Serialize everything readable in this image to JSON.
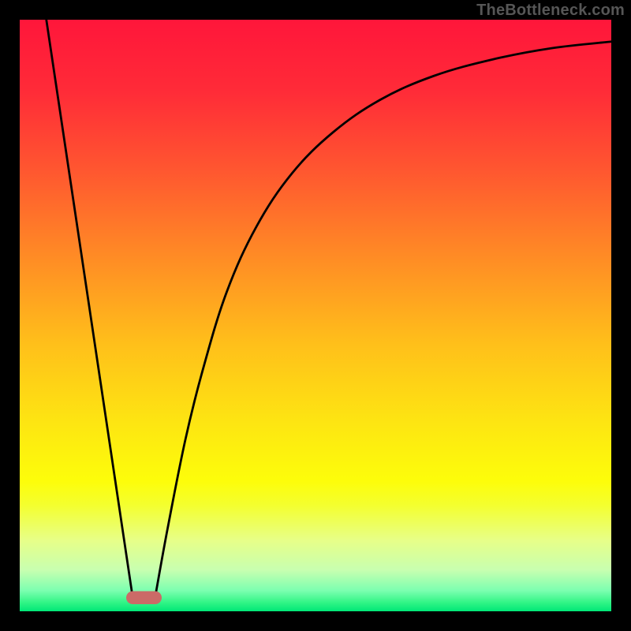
{
  "watermark": "TheBottleneck.com",
  "chart_data": {
    "type": "line",
    "title": "",
    "xlabel": "",
    "ylabel": "",
    "xlim": [
      0,
      100
    ],
    "ylim": [
      0,
      100
    ],
    "gradient_stops": [
      {
        "offset": 0.0,
        "color": "#ff163a"
      },
      {
        "offset": 0.12,
        "color": "#ff2b38"
      },
      {
        "offset": 0.25,
        "color": "#ff5530"
      },
      {
        "offset": 0.4,
        "color": "#ff8b25"
      },
      {
        "offset": 0.55,
        "color": "#ffc01a"
      },
      {
        "offset": 0.68,
        "color": "#fde512"
      },
      {
        "offset": 0.78,
        "color": "#fdfd0a"
      },
      {
        "offset": 0.82,
        "color": "#f4ff2e"
      },
      {
        "offset": 0.88,
        "color": "#e7ff88"
      },
      {
        "offset": 0.93,
        "color": "#c8ffb0"
      },
      {
        "offset": 0.965,
        "color": "#7cffb0"
      },
      {
        "offset": 0.985,
        "color": "#32f586"
      },
      {
        "offset": 1.0,
        "color": "#00e777"
      }
    ],
    "series": [
      {
        "name": "left-line",
        "values": [
          {
            "x": 4.5,
            "y": 100
          },
          {
            "x": 19.0,
            "y": 3
          }
        ]
      },
      {
        "name": "right-curve",
        "values": [
          {
            "x": 23.0,
            "y": 3
          },
          {
            "x": 25.0,
            "y": 14
          },
          {
            "x": 28.0,
            "y": 29
          },
          {
            "x": 31.0,
            "y": 41
          },
          {
            "x": 35.0,
            "y": 54
          },
          {
            "x": 40.0,
            "y": 65
          },
          {
            "x": 46.0,
            "y": 74
          },
          {
            "x": 53.0,
            "y": 81
          },
          {
            "x": 61.0,
            "y": 86.5
          },
          {
            "x": 70.0,
            "y": 90.5
          },
          {
            "x": 80.0,
            "y": 93.3
          },
          {
            "x": 90.0,
            "y": 95.2
          },
          {
            "x": 100.0,
            "y": 96.3
          }
        ]
      }
    ],
    "marker": {
      "x_center": 21.0,
      "y": 2.3,
      "width": 6.0,
      "height": 2.2,
      "color": "#cb6a67"
    }
  }
}
